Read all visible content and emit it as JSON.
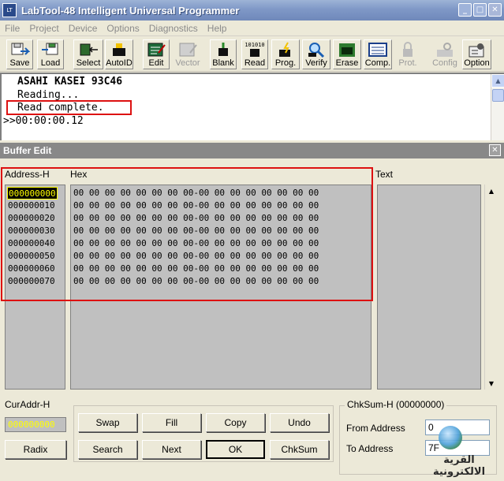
{
  "window": {
    "title": "LabTool-48 Intelligent Universal Programmer",
    "icon_name": "labtool-app-icon",
    "minimize_label": "_",
    "maximize_label": "□",
    "close_label": "✕"
  },
  "menu": [
    "File",
    "Project",
    "Device",
    "Options",
    "Diagnostics",
    "Help"
  ],
  "toolbar": {
    "buttons": [
      {
        "label": "Save",
        "icon": "save-icon",
        "enabled": true
      },
      {
        "label": "Load",
        "icon": "load-icon",
        "enabled": true
      },
      {
        "label": "Select",
        "icon": "select-icon",
        "enabled": true
      },
      {
        "label": "AutoID",
        "icon": "autoid-icon",
        "enabled": true
      },
      {
        "label": "Edit",
        "icon": "edit-icon",
        "enabled": true
      },
      {
        "label": "Vector",
        "icon": "vector-icon",
        "enabled": false
      },
      {
        "label": "Blank",
        "icon": "blank-icon",
        "enabled": true
      },
      {
        "label": "Read",
        "icon": "read-icon",
        "enabled": true,
        "icon_text": "101010"
      },
      {
        "label": "Prog.",
        "icon": "program-icon",
        "enabled": true
      },
      {
        "label": "Verify",
        "icon": "verify-icon",
        "enabled": true
      },
      {
        "label": "Erase",
        "icon": "erase-icon",
        "enabled": true
      },
      {
        "label": "Comp.",
        "icon": "compare-icon",
        "enabled": true
      },
      {
        "label": "Prot.",
        "icon": "protect-icon",
        "enabled": false
      },
      {
        "label": "Config",
        "icon": "config-icon",
        "enabled": false
      },
      {
        "label": "Option",
        "icon": "option-icon",
        "enabled": true
      }
    ]
  },
  "log": {
    "lines": [
      "ASAHI KASEI 93C46",
      "Reading...",
      "Read complete.",
      ">>00:00:00.12"
    ]
  },
  "buffer_edit": {
    "title": "Buffer Edit",
    "close_label": "✕",
    "address_header": "Address-H",
    "hex_header": "Hex",
    "text_header": "Text",
    "addresses": [
      "000000000",
      "000000010",
      "000000020",
      "000000030",
      "000000040",
      "000000050",
      "000000060",
      "000000070"
    ],
    "hex_rows": [
      "00 00 00 00 00 00 00 00-00 00 00 00 00 00 00 00",
      "00 00 00 00 00 00 00 00-00 00 00 00 00 00 00 00",
      "00 00 00 00 00 00 00 00-00 00 00 00 00 00 00 00",
      "00 00 00 00 00 00 00 00-00 00 00 00 00 00 00 00",
      "00 00 00 00 00 00 00 00-00 00 00 00 00 00 00 00",
      "00 00 00 00 00 00 00 00-00 00 00 00 00 00 00 00",
      "00 00 00 00 00 00 00 00-00 00 00 00 00 00 00 00",
      "00 00 00 00 00 00 00 00-00 00 00 00 00 00 00 00"
    ]
  },
  "bottom": {
    "curaddr_label": "CurAddr-H",
    "curaddr_value": "000000000",
    "radix_label": "Radix",
    "buttons": {
      "swap": "Swap",
      "fill": "Fill",
      "copy": "Copy",
      "undo": "Undo",
      "search": "Search",
      "next": "Next",
      "ok": "OK",
      "chksum": "ChkSum"
    },
    "checksum": {
      "legend": "ChkSum-H (00000000)",
      "from_label": "From Address",
      "from_value": "0",
      "to_label": "To Address",
      "to_value": "7F"
    }
  },
  "watermark": {
    "text": "القرية الالكترونية"
  },
  "colors": {
    "highlight_red": "#dd1111",
    "selected_addr_text": "#ffff00",
    "panel_title_bg": "#888888"
  }
}
